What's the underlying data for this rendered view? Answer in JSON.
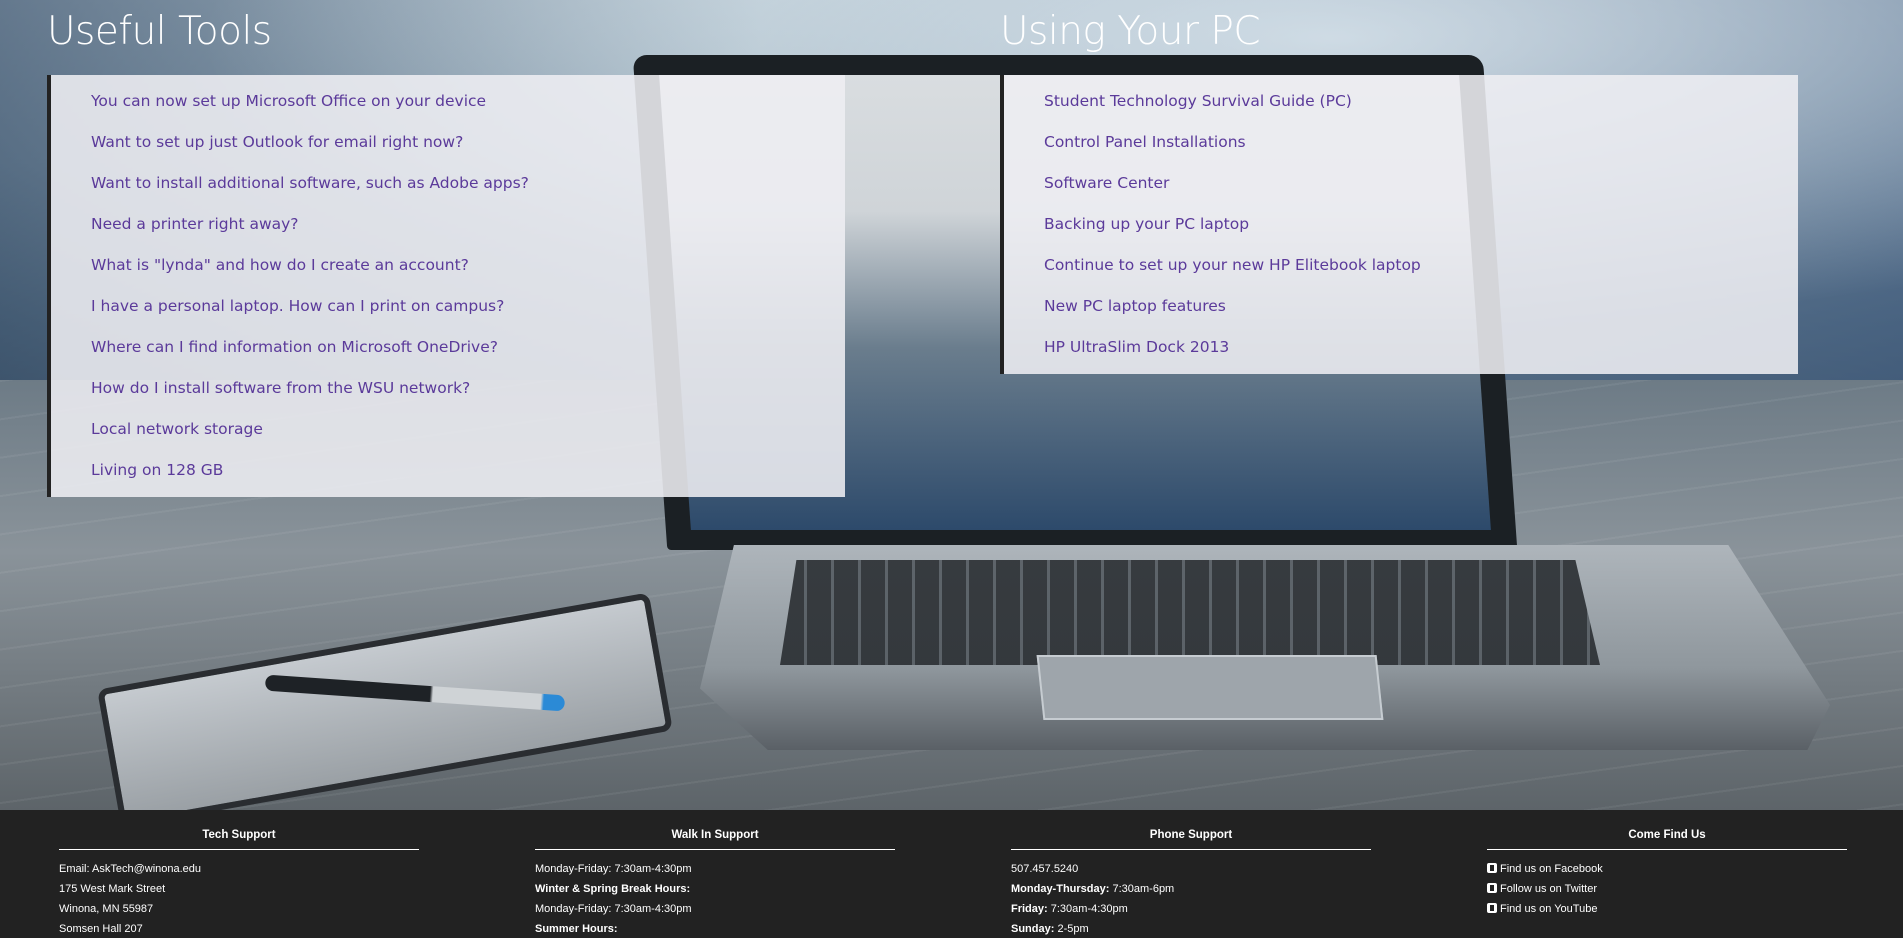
{
  "useful_tools": {
    "title": "Useful Tools",
    "links": [
      "You can now set up Microsoft Office on your device",
      "Want to set up just Outlook for email right now?",
      "Want to install additional software, such as Adobe apps?",
      "Need a printer right away?",
      "What is \"lynda\" and how do I create an account?",
      "I have a personal laptop. How can I print on campus?",
      "Where can I find information on Microsoft OneDrive?",
      "How do I install software from the WSU network?",
      "Local network storage",
      "Living on 128 GB"
    ]
  },
  "using_your_pc": {
    "title": "Using Your PC",
    "links": [
      "Student Technology Survival Guide (PC)",
      "Control Panel Installations",
      "Software Center",
      "Backing up your PC laptop",
      "Continue to set up your new HP Elitebook laptop",
      "New PC laptop features",
      "HP UltraSlim Dock 2013"
    ]
  },
  "footer": {
    "tech_support": {
      "heading": "Tech Support",
      "email": "Email: AskTech@winona.edu",
      "street": "175 West Mark Street",
      "city": "Winona, MN 55987",
      "room": "Somsen Hall 207"
    },
    "walk_in": {
      "heading": "Walk In Support",
      "hours1": "Monday-Friday: 7:30am-4:30pm",
      "break_label": "Winter & Spring Break Hours:",
      "hours2": "Monday-Friday: 7:30am-4:30pm",
      "summer_label": "Summer Hours:"
    },
    "phone": {
      "heading": "Phone Support",
      "number": "507.457.5240",
      "mon_thu_label": "Monday-Thursday:",
      "mon_thu_hours": "7:30am-6pm",
      "fri_label": "Friday:",
      "fri_hours": "7:30am-4:30pm",
      "sun_label": "Sunday:",
      "sun_hours": "2-5pm"
    },
    "social": {
      "heading": "Come Find Us",
      "facebook": "Find us on Facebook",
      "twitter": "Follow us on Twitter",
      "youtube": "Find us on YouTube",
      "facebook_icon": "facebook-icon",
      "twitter_icon": "twitter-icon",
      "youtube_icon": "youtube-icon"
    }
  },
  "colors": {
    "link": "#5b3a9a",
    "footer_bg": "#222222",
    "panel_bg": "#eeeef2"
  }
}
